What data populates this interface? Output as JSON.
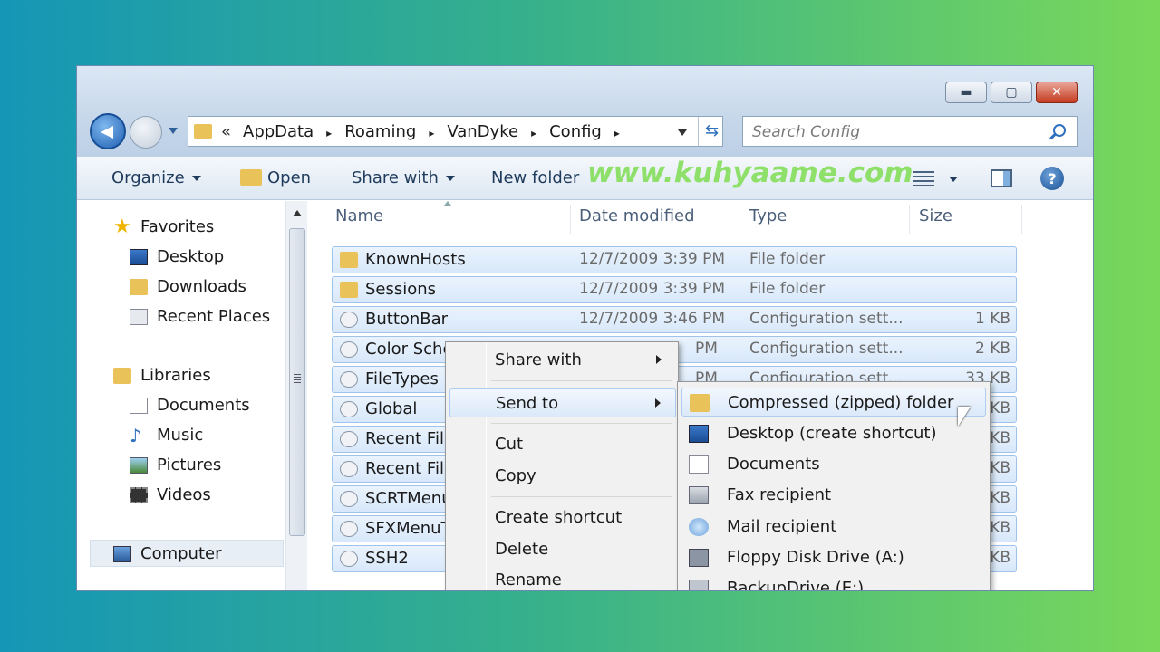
{
  "address": {
    "prefix": "«",
    "crumbs": [
      "AppData",
      "Roaming",
      "VanDyke",
      "Config"
    ],
    "separator": "▸"
  },
  "search": {
    "placeholder": "Search Config"
  },
  "window_controls": {
    "minimize": "▬",
    "maximize": "▢",
    "close": "✕"
  },
  "toolbar": {
    "organize": "Organize",
    "open": "Open",
    "share_with": "Share with",
    "new_folder": "New folder",
    "watermark": "www.kuhyaame.com",
    "help": "?"
  },
  "nav": {
    "favorites": "Favorites",
    "desktop": "Desktop",
    "downloads": "Downloads",
    "recent_places": "Recent Places",
    "libraries": "Libraries",
    "documents": "Documents",
    "music": "Music",
    "pictures": "Pictures",
    "videos": "Videos",
    "computer": "Computer"
  },
  "columns": {
    "name": "Name",
    "date": "Date modified",
    "type": "Type",
    "size": "Size"
  },
  "files": [
    {
      "name": "KnownHosts",
      "date": "12/7/2009 3:39 PM",
      "type": "File folder",
      "size": ""
    },
    {
      "name": "Sessions",
      "date": "12/7/2009 3:39 PM",
      "type": "File folder",
      "size": ""
    },
    {
      "name": "ButtonBar",
      "date": "12/7/2009 3:46 PM",
      "type": "Configuration sett...",
      "size": "1 KB"
    },
    {
      "name": "Color Sche",
      "date": "PM",
      "type": "Configuration sett...",
      "size": "2 KB"
    },
    {
      "name": "FileTypes",
      "date": "PM",
      "type": "Configuration sett...",
      "size": "33 KB"
    },
    {
      "name": "Global",
      "date": "",
      "type": "",
      "size": "KB"
    },
    {
      "name": "Recent File",
      "date": "",
      "type": "",
      "size": "KB"
    },
    {
      "name": "Recent File",
      "date": "",
      "type": "",
      "size": "KB"
    },
    {
      "name": "SCRTMenu",
      "date": "",
      "type": "",
      "size": "KB"
    },
    {
      "name": "SFXMenuT",
      "date": "",
      "type": "",
      "size": "KB"
    },
    {
      "name": "SSH2",
      "date": "",
      "type": "",
      "size": "KB"
    }
  ],
  "context_menu": {
    "share_with": "Share with",
    "send_to": "Send to",
    "cut": "Cut",
    "copy": "Copy",
    "create_shortcut": "Create shortcut",
    "delete": "Delete",
    "rename": "Rename"
  },
  "send_to_menu": [
    {
      "label": "Compressed (zipped) folder",
      "icon": "zip-folder-icon"
    },
    {
      "label": "Desktop (create shortcut)",
      "icon": "desktop-icon"
    },
    {
      "label": "Documents",
      "icon": "documents-icon"
    },
    {
      "label": "Fax recipient",
      "icon": "fax-icon"
    },
    {
      "label": "Mail recipient",
      "icon": "mail-icon"
    },
    {
      "label": "Floppy Disk Drive (A:)",
      "icon": "floppy-icon"
    },
    {
      "label": "BackupDrive (E:)",
      "icon": "drive-icon"
    }
  ]
}
